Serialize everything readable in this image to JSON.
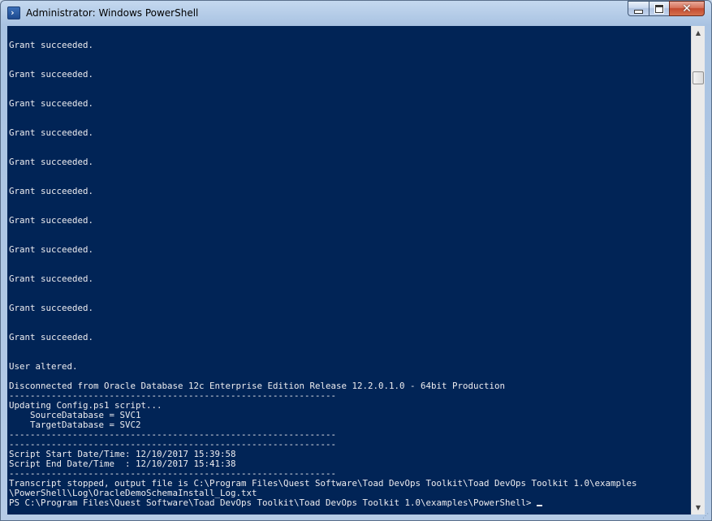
{
  "window": {
    "title": "Administrator: Windows PowerShell",
    "icon": "powershell-icon",
    "icon_glyph": "›"
  },
  "caption_buttons": {
    "minimize": "minimize-icon",
    "maximize": "maximize-icon",
    "close": "close-icon",
    "close_glyph": "✕"
  },
  "console": {
    "background": "#012456",
    "foreground": "#eeedf0",
    "lines": [
      "Grant succeeded.",
      "",
      "",
      "Grant succeeded.",
      "",
      "",
      "Grant succeeded.",
      "",
      "",
      "Grant succeeded.",
      "",
      "",
      "Grant succeeded.",
      "",
      "",
      "Grant succeeded.",
      "",
      "",
      "Grant succeeded.",
      "",
      "",
      "Grant succeeded.",
      "",
      "",
      "Grant succeeded.",
      "",
      "",
      "Grant succeeded.",
      "",
      "",
      "Grant succeeded.",
      "",
      "",
      "User altered.",
      "",
      "Disconnected from Oracle Database 12c Enterprise Edition Release 12.2.0.1.0 - 64bit Production",
      "--------------------------------------------------------------",
      "Updating Config.ps1 script...",
      "    SourceDatabase = SVC1",
      "    TargetDatabase = SVC2",
      "--------------------------------------------------------------",
      "--------------------------------------------------------------",
      "Script Start Date/Time: 12/10/2017 15:39:58",
      "Script End Date/Time  : 12/10/2017 15:41:38",
      "--------------------------------------------------------------",
      "Transcript stopped, output file is C:\\Program Files\\Quest Software\\Toad DevOps Toolkit\\Toad DevOps Toolkit 1.0\\examples",
      "\\PowerShell\\Log\\OracleDemoSchemaInstall_Log.txt"
    ],
    "prompt": "PS C:\\Program Files\\Quest Software\\Toad DevOps Toolkit\\Toad DevOps Toolkit 1.0\\examples\\PowerShell> "
  },
  "scrollbar": {
    "up_icon": "arrow-up-icon",
    "down_icon": "arrow-down-icon",
    "up_glyph": "▲",
    "down_glyph": "▼",
    "position_fraction": 0.93
  },
  "resize_grip_glyph": "⋰"
}
